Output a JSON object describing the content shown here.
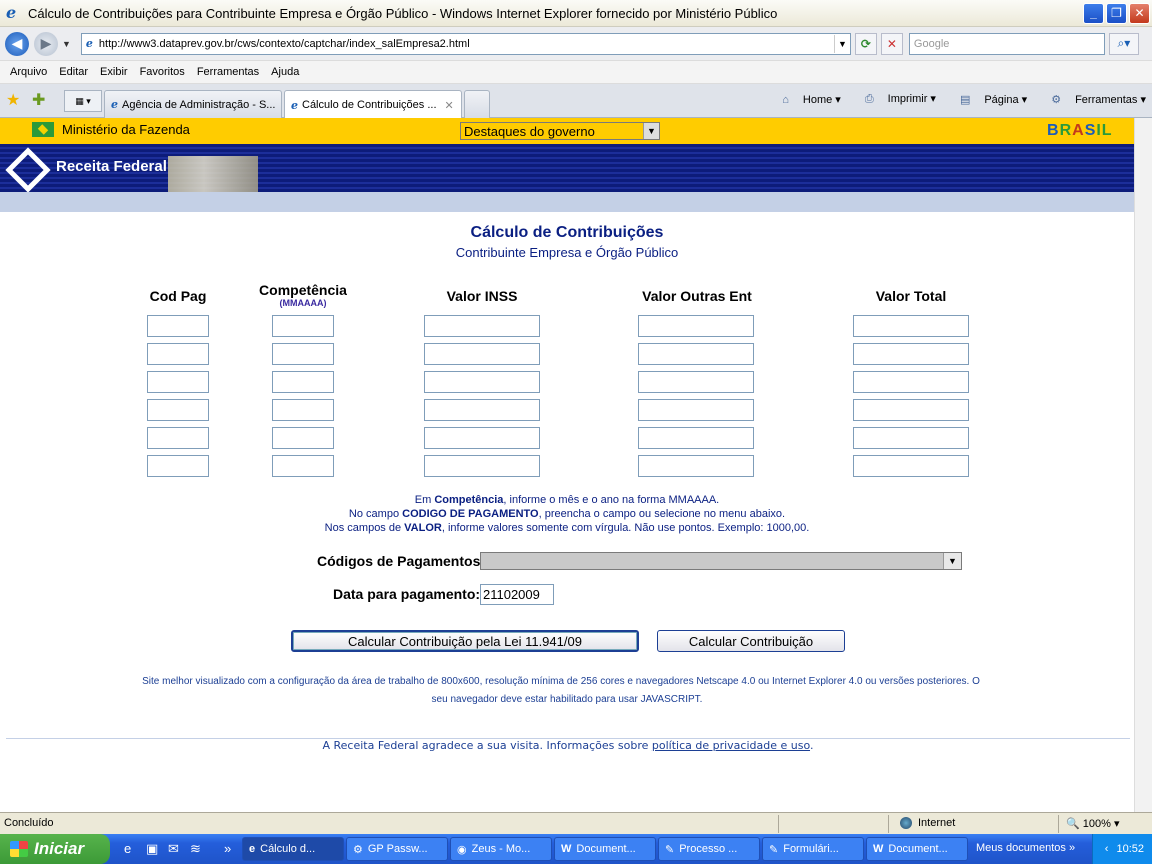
{
  "window": {
    "title": "Cálculo de Contribuições para Contribuinte Empresa e Órgão Público - Windows Internet Explorer fornecido por Ministério Público"
  },
  "addressbar": {
    "url": "http://www3.dataprev.gov.br/cws/contexto/captchar/index_salEmpresa2.html",
    "search_placeholder": "Google"
  },
  "menu": [
    "Arquivo",
    "Editar",
    "Exibir",
    "Favoritos",
    "Ferramentas",
    "Ajuda"
  ],
  "tabs": [
    {
      "label": "Agência de Administração - S...",
      "active": false
    },
    {
      "label": "Cálculo de Contribuições ...",
      "active": true
    }
  ],
  "toolbar": {
    "home": "Home",
    "print": "Imprimir",
    "page": "Página",
    "tools": "Ferramentas"
  },
  "govbar": {
    "ministry": "Ministério da Fazenda",
    "dropdown": "Destaques do governo",
    "brasil": "BRASIL"
  },
  "banner": {
    "logo_text": "Receita Federal"
  },
  "page": {
    "title": "Cálculo de Contribuições",
    "subtitle": "Contribuinte Empresa e Órgão Público",
    "columns": {
      "codpag": "Cod Pag",
      "competencia": "Competência",
      "competencia_hint": "(MMAAAA)",
      "inss": "Valor INSS",
      "outras": "Valor Outras Ent",
      "total": "Valor Total"
    },
    "info": {
      "line1_pre": "Em ",
      "line1_bold": "Competência",
      "line1_post": ", informe o mês e o ano na forma MMAAAA.",
      "line2_pre": "No campo ",
      "line2_bold": "CODIGO DE PAGAMENTO",
      "line2_post": ", preencha o campo ou selecione no menu abaixo.",
      "line3_pre": "Nos campos de ",
      "line3_bold": "VALOR",
      "line3_post": ", informe valores somente com vírgula. Não use pontos. Exemplo: 1000,00."
    },
    "codes_label": "Códigos de Pagamentos:",
    "date_label": "Data para pagamento:",
    "date_value": "21102009",
    "btn_lei": "Calcular Contribuição pela Lei 11.941/09",
    "btn_calc": "Calcular Contribuição",
    "footer1": "Site melhor visualizado com a configuração da área de trabalho de 800x600, resolução mínima de 256 cores e  navegadores Netscape 4.0 ou Internet Explorer 4.0 ou versões posteriores.  O",
    "footer2": "seu navegador deve estar habilitado para usar JAVASCRIPT.",
    "thanks_pre": "A Receita Federal agradece a sua visita. Informações sobre ",
    "thanks_link": "política de privacidade e uso",
    "thanks_post": "."
  },
  "statusbar": {
    "status": "Concluído",
    "zone": "Internet",
    "zoom": "100%"
  },
  "taskbar": {
    "start": "Iniciar",
    "tasks": [
      {
        "label": "Cálculo d...",
        "active": true
      },
      {
        "label": "GP Passw...",
        "active": false
      },
      {
        "label": "Zeus - Mo...",
        "active": false
      },
      {
        "label": "Document...",
        "active": false
      },
      {
        "label": "Processo ...",
        "active": false
      },
      {
        "label": "Formulári...",
        "active": false
      },
      {
        "label": "Document...",
        "active": false
      }
    ],
    "tray_label": "Meus documentos",
    "clock": "10:52"
  }
}
